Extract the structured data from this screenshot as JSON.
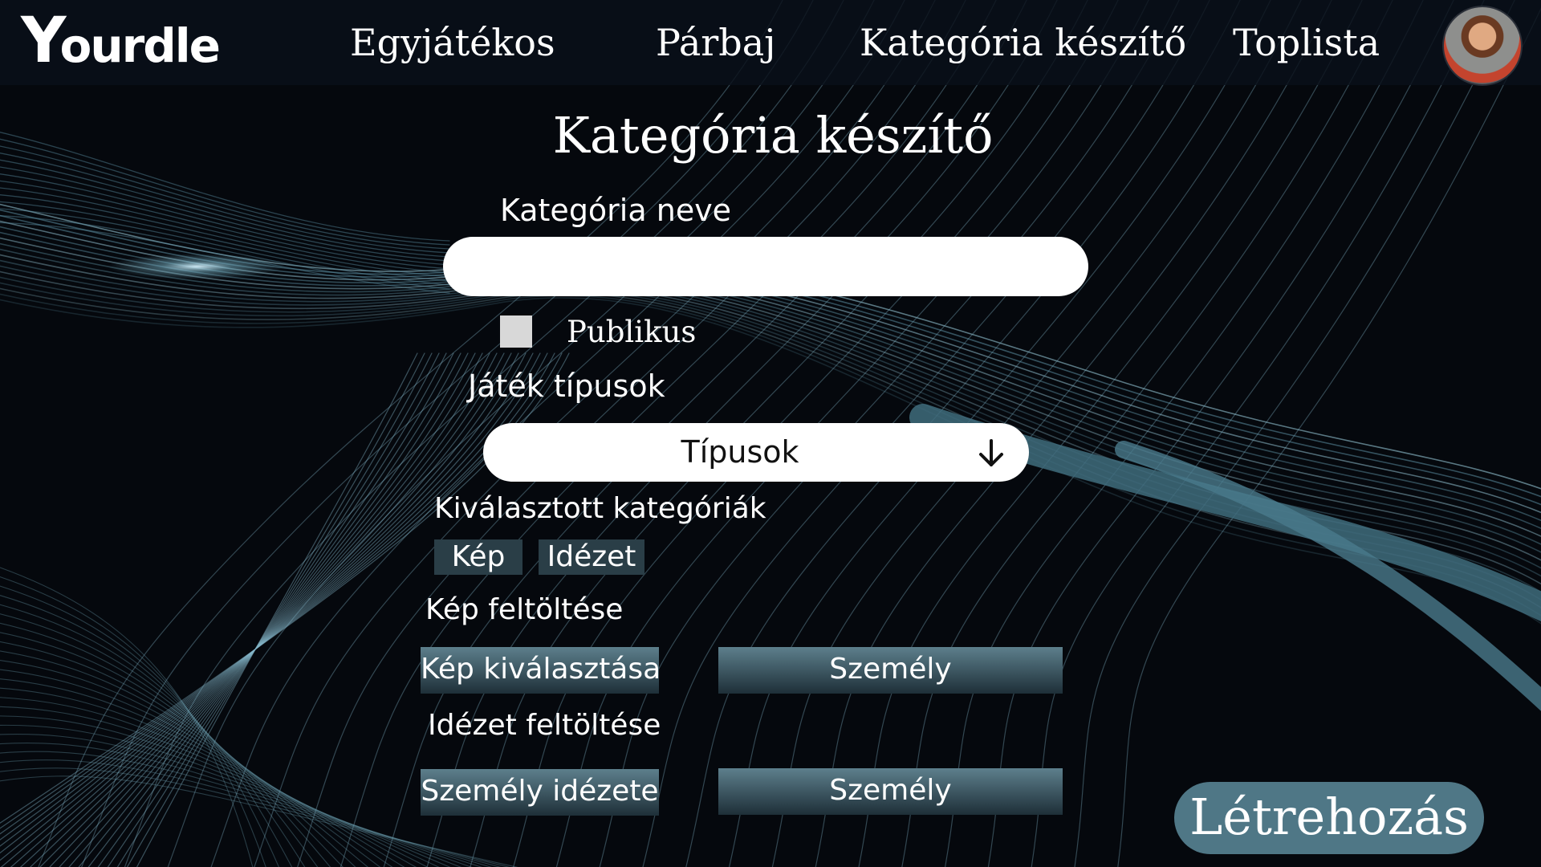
{
  "app": {
    "logo": "ourdle",
    "logo_initial": "Y"
  },
  "nav": {
    "items": [
      {
        "label": "Egyjátékos"
      },
      {
        "label": "Párbaj"
      },
      {
        "label": "Kategória készítő"
      },
      {
        "label": "Toplista"
      }
    ]
  },
  "page": {
    "title": "Kategória készítő"
  },
  "form": {
    "category_name_label": "Kategória neve",
    "category_name_value": "",
    "public_label": "Publikus",
    "public_checked": false,
    "game_types_label": "Játék típusok",
    "game_types_selected": "Típusok",
    "selected_categories_label": "Kiválasztott kategóriák",
    "selected_categories": [
      {
        "label": "Kép"
      },
      {
        "label": "Idézet"
      }
    ],
    "image_upload_label": "Kép feltöltése",
    "choose_image_button": "Kép kiválasztása",
    "image_person_button": "Személy",
    "quote_upload_label": "Idézet feltöltése",
    "person_quote_button": "Személy idézete",
    "quote_person_button": "Személy",
    "create_button": "Létrehozás"
  },
  "colors": {
    "background": "#05080d",
    "accent": "#4f7786",
    "chip": "#2a3e47",
    "checkbox": "#d8d8d8"
  },
  "icons": {
    "dropdown": "arrow-down-icon"
  }
}
